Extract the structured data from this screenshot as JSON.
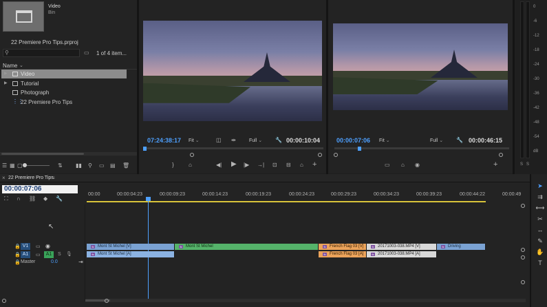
{
  "project": {
    "bin_title": "Video",
    "bin_subtitle": "Bin",
    "project_file": "22 Premiere Pro Tips.prproj",
    "item_count": "1 of 4 item...",
    "column_name": "Name",
    "items": [
      {
        "label": "Video",
        "selected": true
      },
      {
        "label": "Tutorial",
        "selected": false
      },
      {
        "label": "Photograph",
        "selected": false
      },
      {
        "label": "22 Premiere Pro Tips",
        "selected": false
      }
    ]
  },
  "source_monitor": {
    "timecode": "07:24:38:17",
    "fit": "Fit",
    "quality": "Full",
    "duration": "00:00:10:04"
  },
  "program_monitor": {
    "timecode": "00:00:07:06",
    "fit": "Fit",
    "quality": "Full",
    "duration": "00:00:46:15"
  },
  "timeline": {
    "sequence_name": "22 Premiere Pro Tips",
    "timecode": "00:00:07:06",
    "ruler": [
      "00:00",
      "00:00:04:23",
      "00:00:09:23",
      "00:00:14:23",
      "00:00:19:23",
      "00:00:24:23",
      "00:00:29:23",
      "00:00:34:23",
      "00:00:39:23",
      "00:00:44:22",
      "00:00:49"
    ],
    "tracks": {
      "v1": "V1",
      "a1": "A1",
      "a1_source": "A1",
      "master": "Master",
      "master_level": "0.0"
    },
    "video_clips": [
      "Mont St Michel [V]",
      "Mont St Michel",
      "French Flag 03 [V]",
      "20171003-038.MP4 [V]",
      "Driving"
    ],
    "audio_clips": [
      "Mont St Michel [A]",
      "French Flag 03 [A]",
      "20171003-038.MP4 [A]"
    ]
  },
  "meter": {
    "scale": [
      "0",
      "-6",
      "-12",
      "-18",
      "-24",
      "-30",
      "-36",
      "-42",
      "-48",
      "-54",
      "dB"
    ],
    "footer": [
      "S",
      "S"
    ]
  },
  "colors": {
    "accent_blue": "#4ea0ff",
    "video_clip": "#7aa2d3",
    "green_clip": "#55b36a",
    "orange_clip": "#eba35a"
  }
}
